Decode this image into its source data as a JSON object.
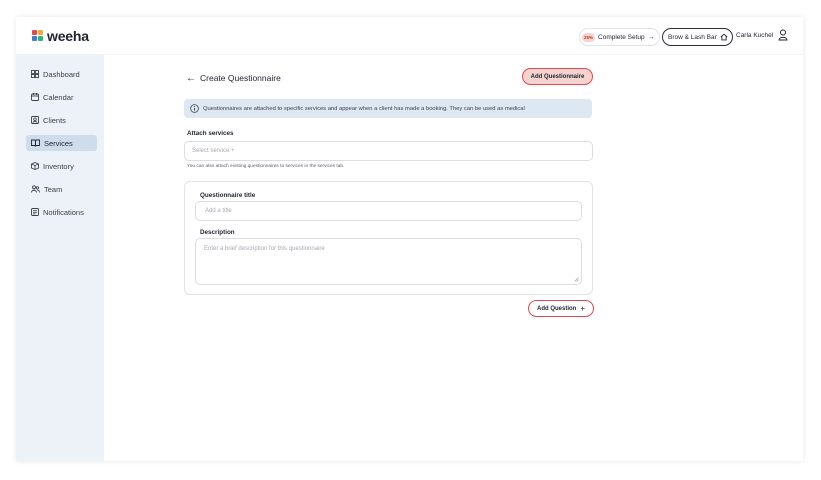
{
  "brand": {
    "name": "weeha",
    "logo_colors": [
      "#e5484d",
      "#f2a93b",
      "#3d7dd8",
      "#2fb57a"
    ]
  },
  "header": {
    "setup_percent": "25%",
    "setup_label": "Complete Setup",
    "setup_arrow": "→",
    "business_name": "Brow & Lash Bar",
    "user_name": "Carla Kuchel"
  },
  "sidebar": {
    "items": [
      {
        "label": "Dashboard",
        "icon": "grid-icon"
      },
      {
        "label": "Calendar",
        "icon": "calendar-icon"
      },
      {
        "label": "Clients",
        "icon": "clients-icon"
      },
      {
        "label": "Services",
        "icon": "book-icon",
        "active": true
      },
      {
        "label": "Inventory",
        "icon": "inventory-icon"
      },
      {
        "label": "Team",
        "icon": "team-icon"
      },
      {
        "label": "Notifications",
        "icon": "notifications-icon"
      }
    ]
  },
  "main": {
    "back_arrow": "←",
    "title": "Create Questionnaire",
    "add_questionnaire_label": "Add Questionnaire",
    "info_text": "Questionnaires are attached to specific services and appear when a client has made a booking. They can be used as medical",
    "attach_services_label": "Attach services",
    "select_service_placeholder": "Select service +",
    "attach_hint": "You can also attach existing questionnaires to services in the services tab.",
    "questionnaire_title_label": "Questionnaire title",
    "title_placeholder": "Add a title",
    "description_label": "Description",
    "description_placeholder": "Enter a brief description for this questionnaire",
    "add_question_label": "Add Question",
    "add_question_plus": "+"
  },
  "colors": {
    "accent_red": "#e5484d",
    "accent_pink": "#f6d3ce",
    "sidebar_bg": "#edf1f8",
    "sidebar_active": "#cfdcec",
    "info_bg": "#dde8f3"
  }
}
